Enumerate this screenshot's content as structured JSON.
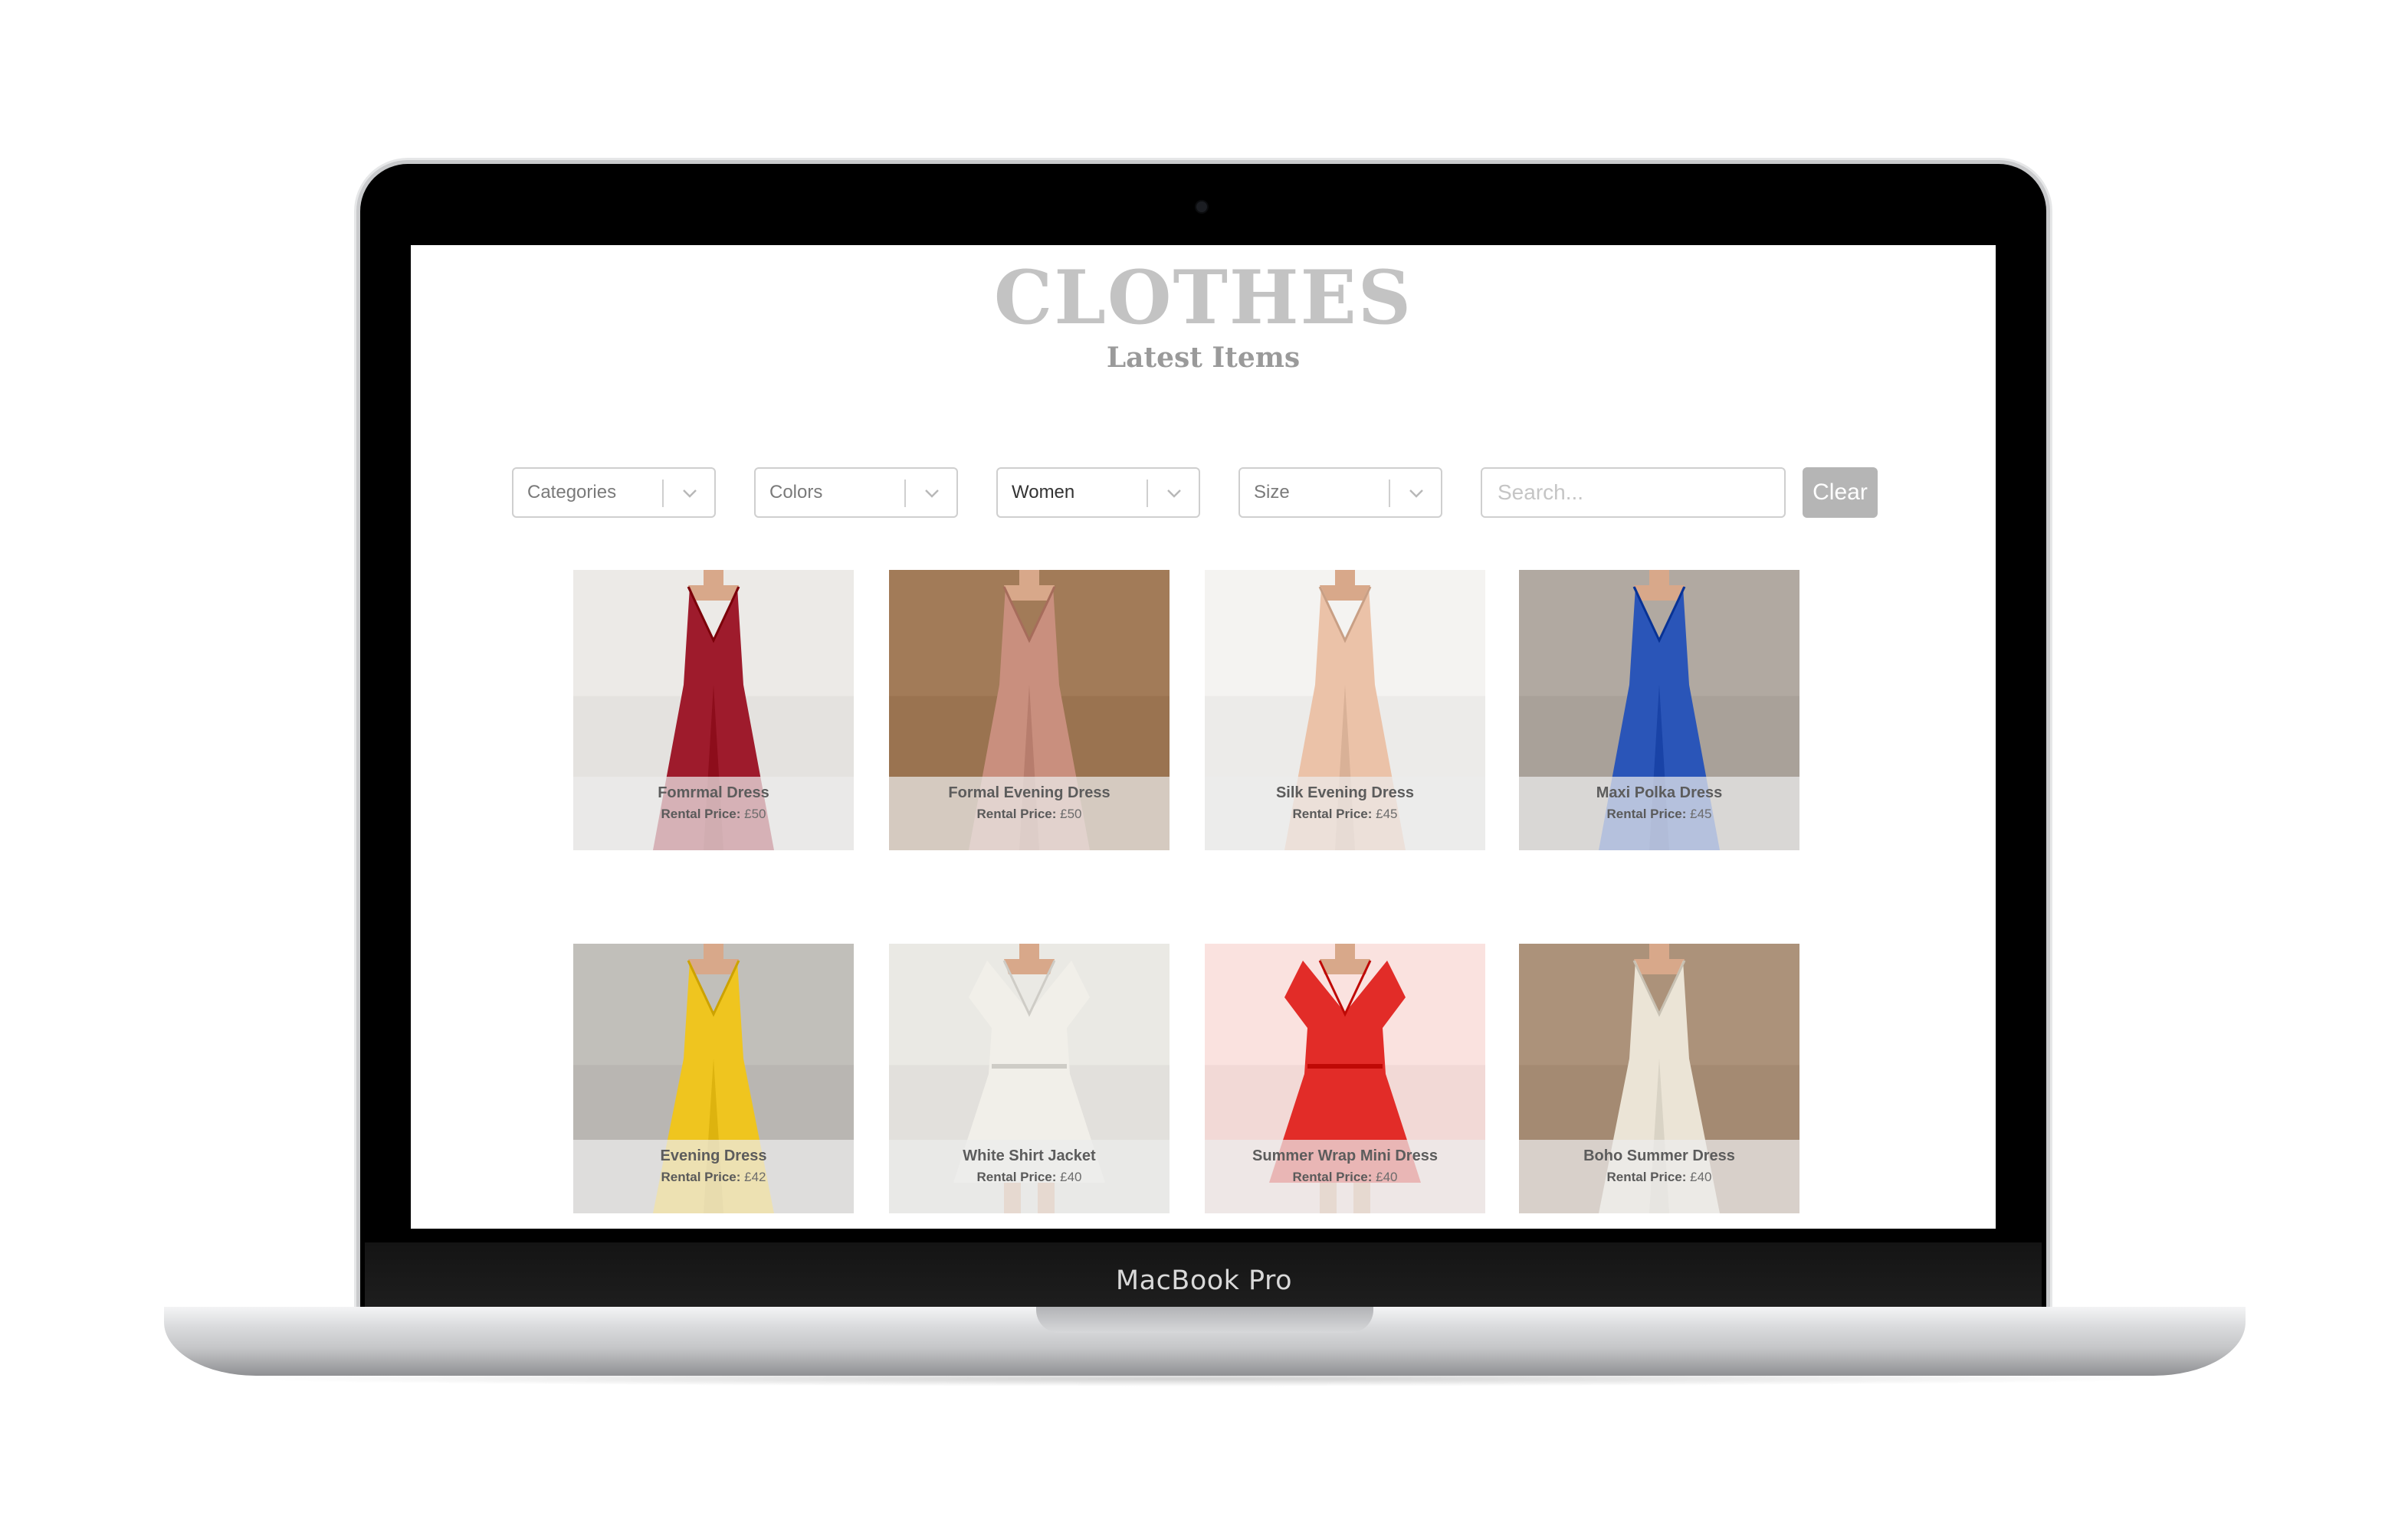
{
  "device": {
    "label": "MacBook Pro"
  },
  "page": {
    "title": "CLOTHES",
    "subtitle": "Latest Items"
  },
  "filters": [
    {
      "label": "Categories",
      "selected": false
    },
    {
      "label": "Colors",
      "selected": false
    },
    {
      "label": "Women",
      "selected": true
    },
    {
      "label": "Size",
      "selected": false
    }
  ],
  "search": {
    "placeholder": "Search...",
    "value": ""
  },
  "clear_label": "Clear",
  "price_label": "Rental Price:",
  "items": [
    {
      "name": "Fomrmal Dress",
      "price": "£50",
      "dress": "#9e1b2c",
      "bg": "#e4e2df",
      "style": "gown"
    },
    {
      "name": "Formal Evening Dress",
      "price": "£50",
      "dress": "#c98f7e",
      "bg": "#9a7350",
      "style": "gown"
    },
    {
      "name": "Silk Evening Dress",
      "price": "£45",
      "dress": "#ebc2a8",
      "bg": "#ecebe9",
      "style": "gown"
    },
    {
      "name": "Maxi Polka Dress",
      "price": "£45",
      "dress": "#2a55b8",
      "bg": "#a9a199",
      "style": "gown"
    },
    {
      "name": "Evening Dress",
      "price": "£42",
      "dress": "#efc51f",
      "bg": "#b9b6b2",
      "style": "gown"
    },
    {
      "name": "White Shirt Jacket",
      "price": "£40",
      "dress": "#f1efe9",
      "bg": "#e2e0dc",
      "style": "short"
    },
    {
      "name": "Summer Wrap Mini Dress",
      "price": "£40",
      "dress": "#e22c28",
      "bg": "#f2d9d6",
      "style": "short"
    },
    {
      "name": "Boho Summer Dress",
      "price": "£40",
      "dress": "#ebe4d6",
      "bg": "#a48a72",
      "style": "gown"
    }
  ]
}
